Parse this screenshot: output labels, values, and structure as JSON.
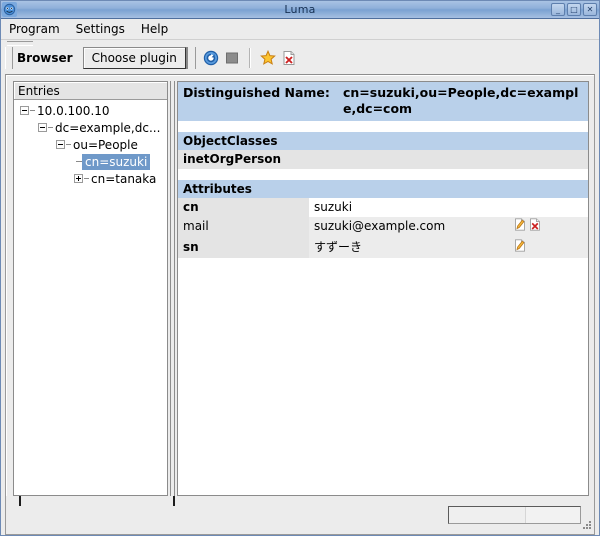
{
  "window": {
    "title": "Luma",
    "app_icon": "luma-app-icon",
    "controls": [
      {
        "name": "minimize",
        "glyph": "_"
      },
      {
        "name": "maximize",
        "glyph": "□"
      },
      {
        "name": "close",
        "glyph": "✕"
      }
    ]
  },
  "menubar": {
    "items": [
      "Program",
      "Settings",
      "Help"
    ]
  },
  "toolbar": {
    "plugin_label": "Browser",
    "choose_plugin_label": "Choose plugin",
    "icons": [
      {
        "name": "refresh-icon",
        "color": "#2f73c8"
      },
      {
        "name": "stop-icon",
        "color": "#8c8c8c"
      },
      {
        "name": "bookmark-star-icon",
        "color": "#f5a623"
      },
      {
        "name": "delete-bookmark-icon",
        "color": "#cc2222"
      }
    ]
  },
  "tree": {
    "header": "Entries",
    "nodes": [
      {
        "label": "10.0.100.10",
        "depth": 0,
        "state": "expanded",
        "selected": false
      },
      {
        "label": "dc=example,dc...",
        "depth": 1,
        "state": "expanded",
        "selected": false
      },
      {
        "label": "ou=People",
        "depth": 2,
        "state": "expanded",
        "selected": false
      },
      {
        "label": "cn=suzuki",
        "depth": 3,
        "state": "leaf",
        "selected": true
      },
      {
        "label": "cn=tanaka",
        "depth": 3,
        "state": "collapsed",
        "selected": false
      }
    ]
  },
  "detail": {
    "dn_label": "Distinguished Name:",
    "dn_value": "cn=suzuki,ou=People,dc=example,dc=com",
    "objectclasses_header": "ObjectClasses",
    "objectclasses": [
      "inetOrgPerson"
    ],
    "attributes_header": "Attributes",
    "attributes": [
      {
        "name": "cn",
        "value": "suzuki",
        "bold": true,
        "shaded": false,
        "actions": []
      },
      {
        "name": "mail",
        "value": "suzuki@example.com",
        "bold": false,
        "shaded": true,
        "actions": [
          "edit-icon",
          "delete-icon"
        ]
      },
      {
        "name": "sn",
        "value": "すずーき",
        "bold": true,
        "shaded": true,
        "actions": [
          "edit-icon"
        ]
      }
    ]
  },
  "statusbar": {
    "text": "",
    "progress_percent": 57
  },
  "colors": {
    "titlebar": "#8fb0da",
    "header_blue": "#b9d0ea",
    "selection_blue": "#6f99c9",
    "row_gray": "#e4e4e4",
    "window_bg": "#ececec"
  }
}
